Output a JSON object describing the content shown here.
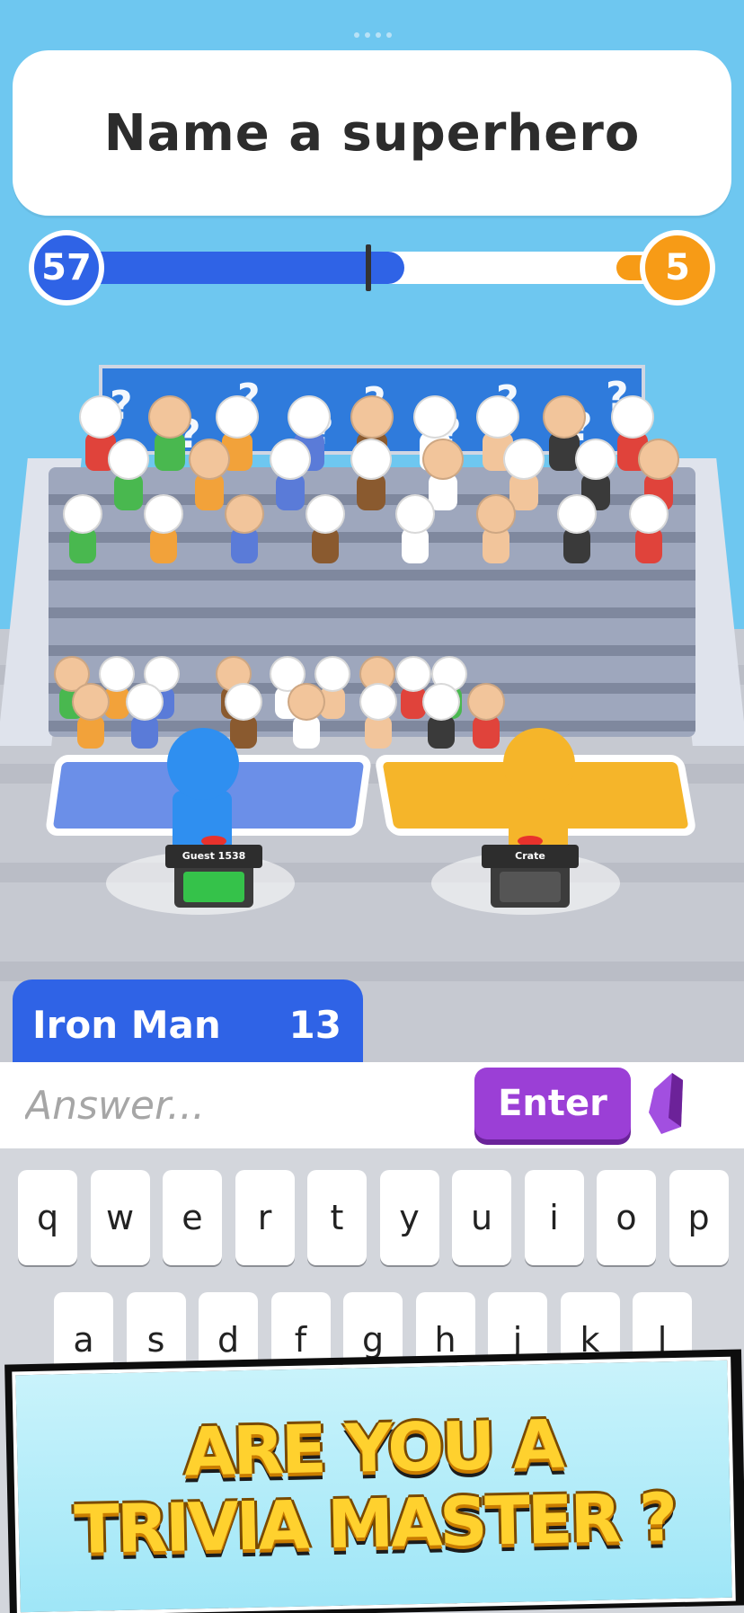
{
  "question": {
    "text": "Name a superhero"
  },
  "score": {
    "left": "57",
    "right": "5",
    "left_fraction": 0.5
  },
  "banner_glyphs": [
    "?",
    "?",
    "?",
    "?",
    "?",
    "?",
    "?",
    "?",
    "?"
  ],
  "players": [
    {
      "name": "Guest 1538",
      "color": "#2f8ff0",
      "podium_color": "#35c24a"
    },
    {
      "name": "Crate",
      "color": "#f5b52a",
      "podium_color": "#3c3c3c"
    }
  ],
  "current_answer": {
    "name": "Iron Man",
    "count": "13"
  },
  "input": {
    "placeholder": "Answer...",
    "value": ""
  },
  "enter_label": "Enter",
  "keyboard": {
    "row1": [
      "q",
      "w",
      "e",
      "r",
      "t",
      "y",
      "u",
      "i",
      "o",
      "p"
    ],
    "row2": [
      "a",
      "s",
      "d",
      "f",
      "g",
      "h",
      "j",
      "k",
      "l"
    ]
  },
  "promo": {
    "line1": "ARE YOU A",
    "line2": "TRIVIA MASTER ?"
  },
  "colors": {
    "sky": "#6ec7f0",
    "blue_team": "#2f63e6",
    "orange_team": "#f79b16",
    "enter_purple": "#9b3fd6"
  }
}
